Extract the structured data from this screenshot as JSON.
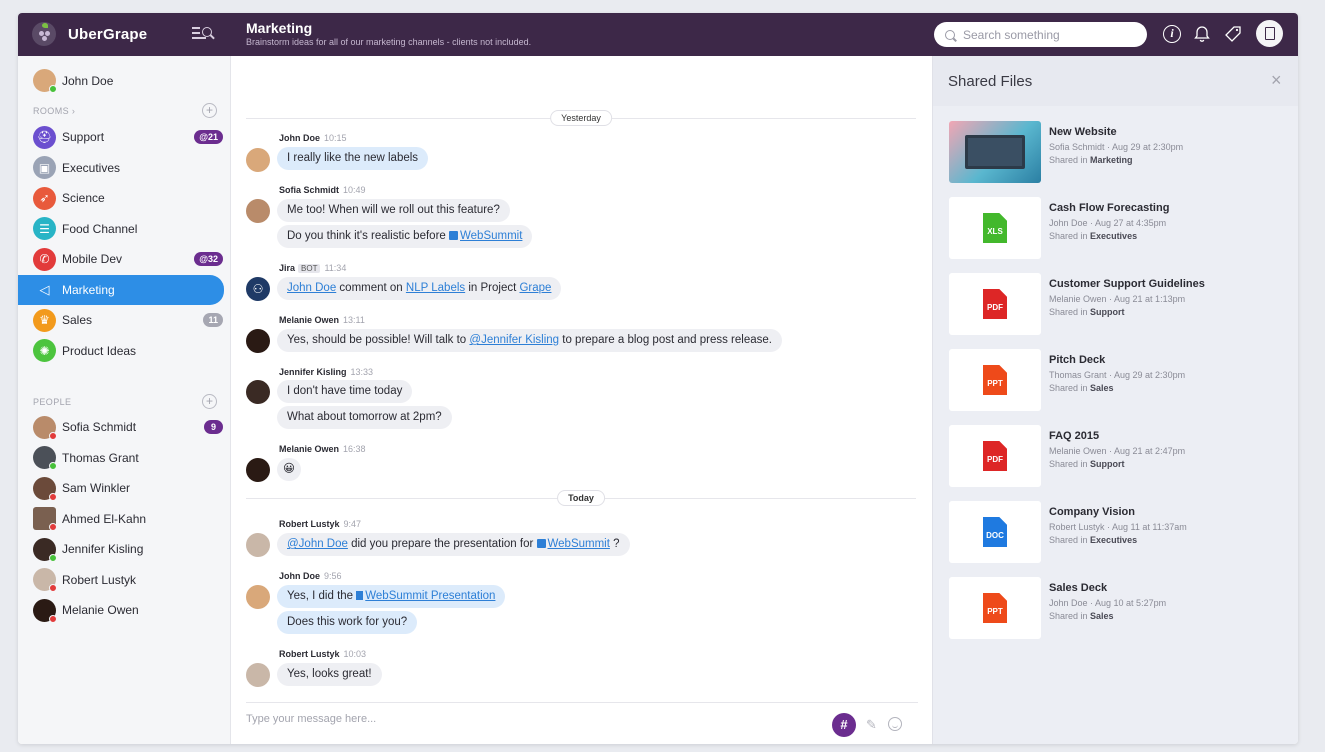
{
  "app": {
    "name": "UberGrape"
  },
  "header": {
    "channel_title": "Marketing",
    "channel_desc": "Brainstorm ideas for all of our marketing channels - clients not included.",
    "search_placeholder": "Search something"
  },
  "sidebar": {
    "me": {
      "name": "John Doe",
      "status": "online"
    },
    "rooms_label": "ROOMS ›",
    "rooms": [
      {
        "name": "Support",
        "color": "#6b4fcf",
        "icon": "support-icon",
        "glyph": "⛑",
        "badge": "@21"
      },
      {
        "name": "Executives",
        "color": "#9aa3b5",
        "icon": "briefcase-icon",
        "glyph": "▣",
        "badge": ""
      },
      {
        "name": "Science",
        "color": "#e85a3c",
        "icon": "rocket-icon",
        "glyph": "➶",
        "badge": ""
      },
      {
        "name": "Food Channel",
        "color": "#28b4c6",
        "icon": "burger-icon",
        "glyph": "☰",
        "badge": ""
      },
      {
        "name": "Mobile Dev",
        "color": "#e23b3b",
        "icon": "phone-icon",
        "glyph": "✆",
        "badge": "@32"
      },
      {
        "name": "Marketing",
        "color": "#2d8ee6",
        "icon": "megaphone-icon",
        "glyph": "📢",
        "badge": "",
        "active": true
      },
      {
        "name": "Sales",
        "color": "#f29a1c",
        "icon": "trophy-icon",
        "glyph": "♛",
        "badge": "11"
      },
      {
        "name": "Product Ideas",
        "color": "#4cc43e",
        "icon": "lightbulb-icon",
        "glyph": "✺",
        "badge": ""
      }
    ],
    "people_label": "PEOPLE",
    "people": [
      {
        "name": "Sofia Schmidt",
        "status": "busy",
        "badge": "9"
      },
      {
        "name": "Thomas Grant",
        "status": "online",
        "badge": ""
      },
      {
        "name": "Sam Winkler",
        "status": "busy",
        "badge": ""
      },
      {
        "name": "Ahmed El-Kahn",
        "status": "busy",
        "badge": ""
      },
      {
        "name": "Jennifer Kisling",
        "status": "online",
        "badge": ""
      },
      {
        "name": "Robert Lustyk",
        "status": "busy",
        "badge": ""
      },
      {
        "name": "Melanie Owen",
        "status": "busy",
        "badge": ""
      }
    ]
  },
  "chat": {
    "day_yesterday": "Yesterday",
    "day_today": "Today",
    "messages": {
      "m1": {
        "author": "John Doe",
        "time": "10:15",
        "text": "I really like the new labels"
      },
      "m2": {
        "author": "Sofia Schmidt",
        "time": "10:49",
        "text": "Me too! When will we roll out this feature?",
        "text2_prefix": "Do you think it's realistic before ",
        "text2_link": "WebSummit"
      },
      "m3": {
        "author": "Jira",
        "bot": "BOT",
        "time": "11:34",
        "link1": "John Doe",
        "mid1": " comment on ",
        "link2": "NLP Labels",
        "mid2": " in Project ",
        "link3": "Grape"
      },
      "m4": {
        "author": "Melanie Owen",
        "time": "13:11",
        "prefix": "Yes, should be possible! Will talk to ",
        "link": "@Jennifer Kisling",
        "suffix": " to prepare a blog post and press release."
      },
      "m5": {
        "author": "Jennifer Kisling",
        "time": "13:33",
        "text": "I don't have time today",
        "text2": "What about tomorrow at 2pm?"
      },
      "m6": {
        "author": "Melanie Owen",
        "time": "16:38",
        "text": "😀"
      },
      "m7": {
        "author": "Robert Lustyk",
        "time": "9:47",
        "link1": "@John Doe",
        "mid": " did you prepare the presentation for ",
        "link2": "WebSummit",
        "suffix": " ?"
      },
      "m8": {
        "author": "John Doe",
        "time": "9:56",
        "prefix": "Yes, I did the ",
        "link": "WebSummit Presentation",
        "text2": "Does this work for you?"
      },
      "m9": {
        "author": "Robert Lustyk",
        "time": "10:03",
        "text": "Yes, looks great!"
      }
    },
    "composer_placeholder": "Type your message here...",
    "hash": "#"
  },
  "files_panel": {
    "title": "Shared Files",
    "close": "×",
    "shared_in": "Shared in",
    "files": [
      {
        "name": "New Website",
        "meta": "Sofia Schmidt · Aug 29 at 2:30pm",
        "room": "Marketing",
        "type": "IMG",
        "color": ""
      },
      {
        "name": "Cash Flow Forecasting",
        "meta": "John Doe · Aug 27 at 4:35pm",
        "room": "Executives",
        "type": "XLS",
        "color": "#43b82c"
      },
      {
        "name": "Customer Support Guidelines",
        "meta": "Melanie Owen · Aug 21 at 1:13pm",
        "room": "Support",
        "type": "PDF",
        "color": "#dd2626"
      },
      {
        "name": "Pitch Deck",
        "meta": "Thomas Grant · Aug 29 at 2:30pm",
        "room": "Sales",
        "type": "PPT",
        "color": "#ee4a1a"
      },
      {
        "name": "FAQ 2015",
        "meta": "Melanie Owen · Aug 21 at 2:47pm",
        "room": "Support",
        "type": "PDF",
        "color": "#dd2626"
      },
      {
        "name": "Company Vision",
        "meta": "Robert Lustyk · Aug 11 at 11:37am",
        "room": "Executives",
        "type": "DOC",
        "color": "#1f7ae0"
      },
      {
        "name": "Sales Deck",
        "meta": "John Doe · Aug 10 at 5:27pm",
        "room": "Sales",
        "type": "PPT",
        "color": "#ee4a1a"
      }
    ]
  },
  "colors": {
    "topbar": "#3d2848",
    "accent": "#2d8ee6",
    "badge_purple": "#6b2d8f",
    "badge_gray": "#a6a7b2",
    "online": "#47c13a",
    "busy": "#e23b3b"
  }
}
